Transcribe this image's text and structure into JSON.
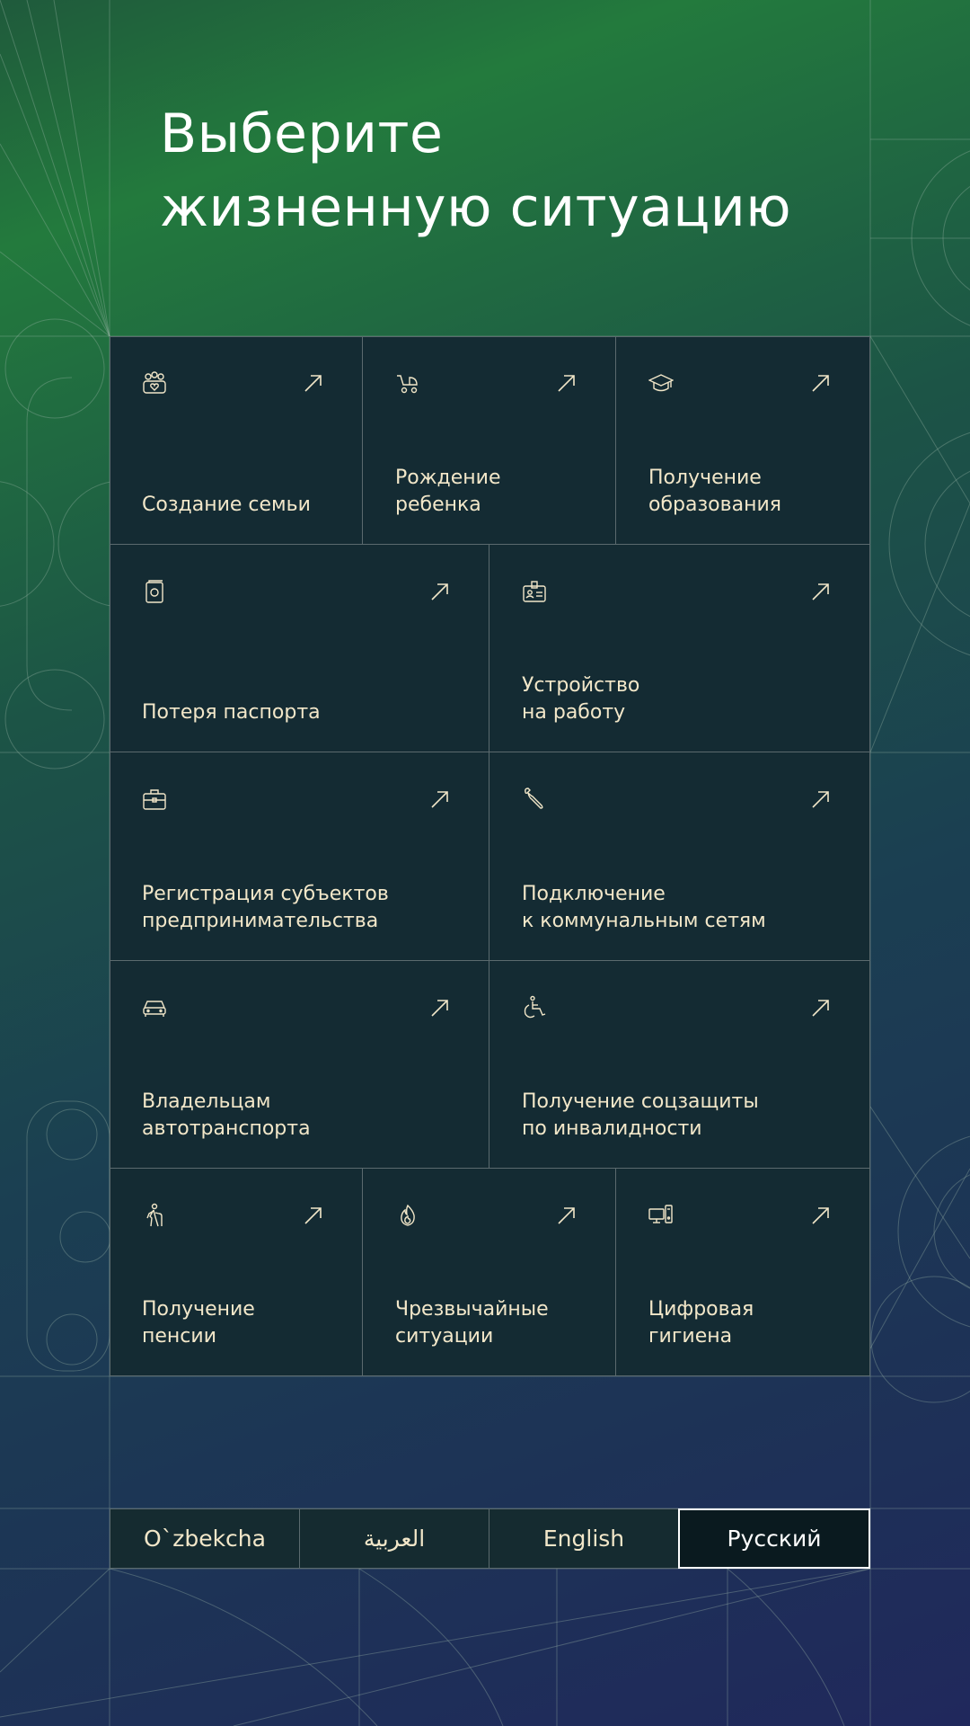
{
  "header": {
    "title": "Выберите\nжизненную ситуацию"
  },
  "colors": {
    "tile_bg": "#142b33",
    "text": "#f2e7c9",
    "border": "#5b6a6e",
    "active_lang_bg": "#0a1a1f"
  },
  "situations": [
    {
      "label": "Создание семьи",
      "icon": "family-icon"
    },
    {
      "label": "Рождение\nребенка",
      "icon": "baby-stroller-icon"
    },
    {
      "label": "Получение\nобразования",
      "icon": "graduation-cap-icon"
    },
    {
      "label": "Потеря паспорта",
      "icon": "passport-icon"
    },
    {
      "label": "Устройство\nна работу",
      "icon": "id-badge-icon"
    },
    {
      "label": "Регистрация субъектов\nпредпринимательства",
      "icon": "briefcase-icon"
    },
    {
      "label": "Подключение\nк коммунальным сетям",
      "icon": "wrench-icon"
    },
    {
      "label": "Владельцам\nавтотранспорта",
      "icon": "car-icon"
    },
    {
      "label": "Получение соцзащиты\nпо инвалидности",
      "icon": "wheelchair-icon"
    },
    {
      "label": "Получение\nпенсии",
      "icon": "elderly-person-icon"
    },
    {
      "label": "Чрезвычайные\nситуации",
      "icon": "fire-icon"
    },
    {
      "label": "Цифровая\nгигиена",
      "icon": "computer-icon"
    }
  ],
  "languages": [
    {
      "label": "O`zbekcha",
      "active": false
    },
    {
      "label": "العربية",
      "active": false
    },
    {
      "label": "English",
      "active": false
    },
    {
      "label": "Русский",
      "active": true
    }
  ]
}
